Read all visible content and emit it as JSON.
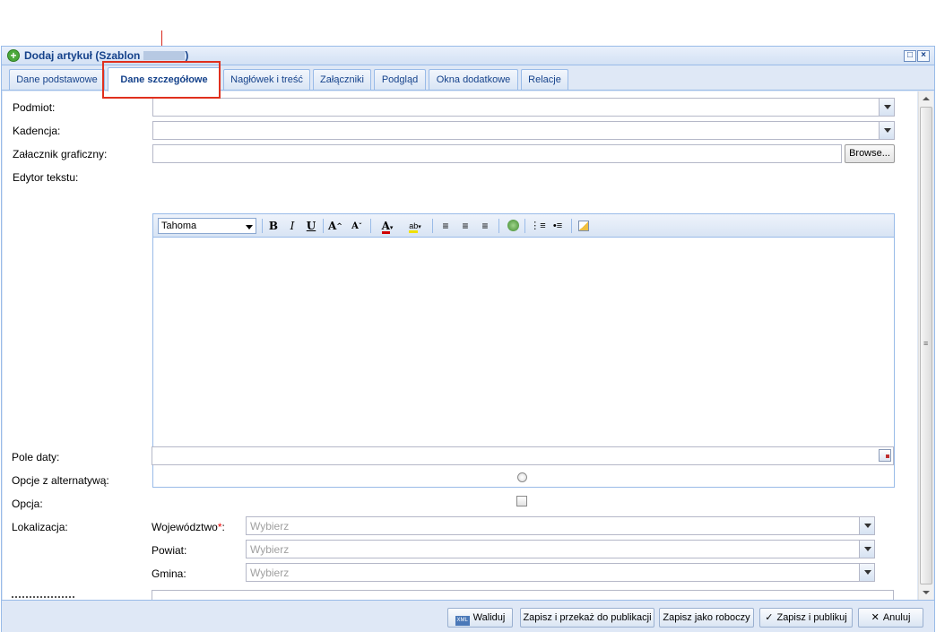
{
  "window": {
    "title": "Dodaj artykuł (Szablon",
    "title_suffix": ")"
  },
  "tabs": [
    {
      "label": "Dane podstawowe"
    },
    {
      "label": "Dane szczegółowe",
      "active": true
    },
    {
      "label": "Nagłówek i treść"
    },
    {
      "label": "Załączniki"
    },
    {
      "label": "Podgląd"
    },
    {
      "label": "Okna dodatkowe"
    },
    {
      "label": "Relacje"
    }
  ],
  "form": {
    "podmiot_label": "Podmiot:",
    "kadencja_label": "Kadencja:",
    "zalacznik_label": "Załacznik graficzny:",
    "browse_label": "Browse...",
    "edytor_label": "Edytor tekstu:",
    "pole_daty_label": "Pole daty:",
    "opcje_alt_label": "Opcje z alternatywą:",
    "opcja_label": "Opcja:",
    "lokalizacja_label": "Lokalizacja:",
    "wojewodztwo_label": "Województwo",
    "required_mark": "*",
    "colon": ":",
    "powiat_label": "Powiat:",
    "gmina_label": "Gmina:",
    "placeholder": "Wybierz"
  },
  "editor": {
    "font": "Tahoma"
  },
  "buttons": {
    "waliduj": "Waliduj",
    "zapisz_przekaz": "Zapisz i przekaż do publikacji",
    "zapisz_roboczy": "Zapisz jako roboczy",
    "zapisz_publikuj": "Zapisz i publikuj",
    "anuluj": "Anuluj"
  },
  "colors": {
    "accent": "#15428b",
    "annotation": "#e0301e",
    "panel": "#dfe8f6"
  }
}
